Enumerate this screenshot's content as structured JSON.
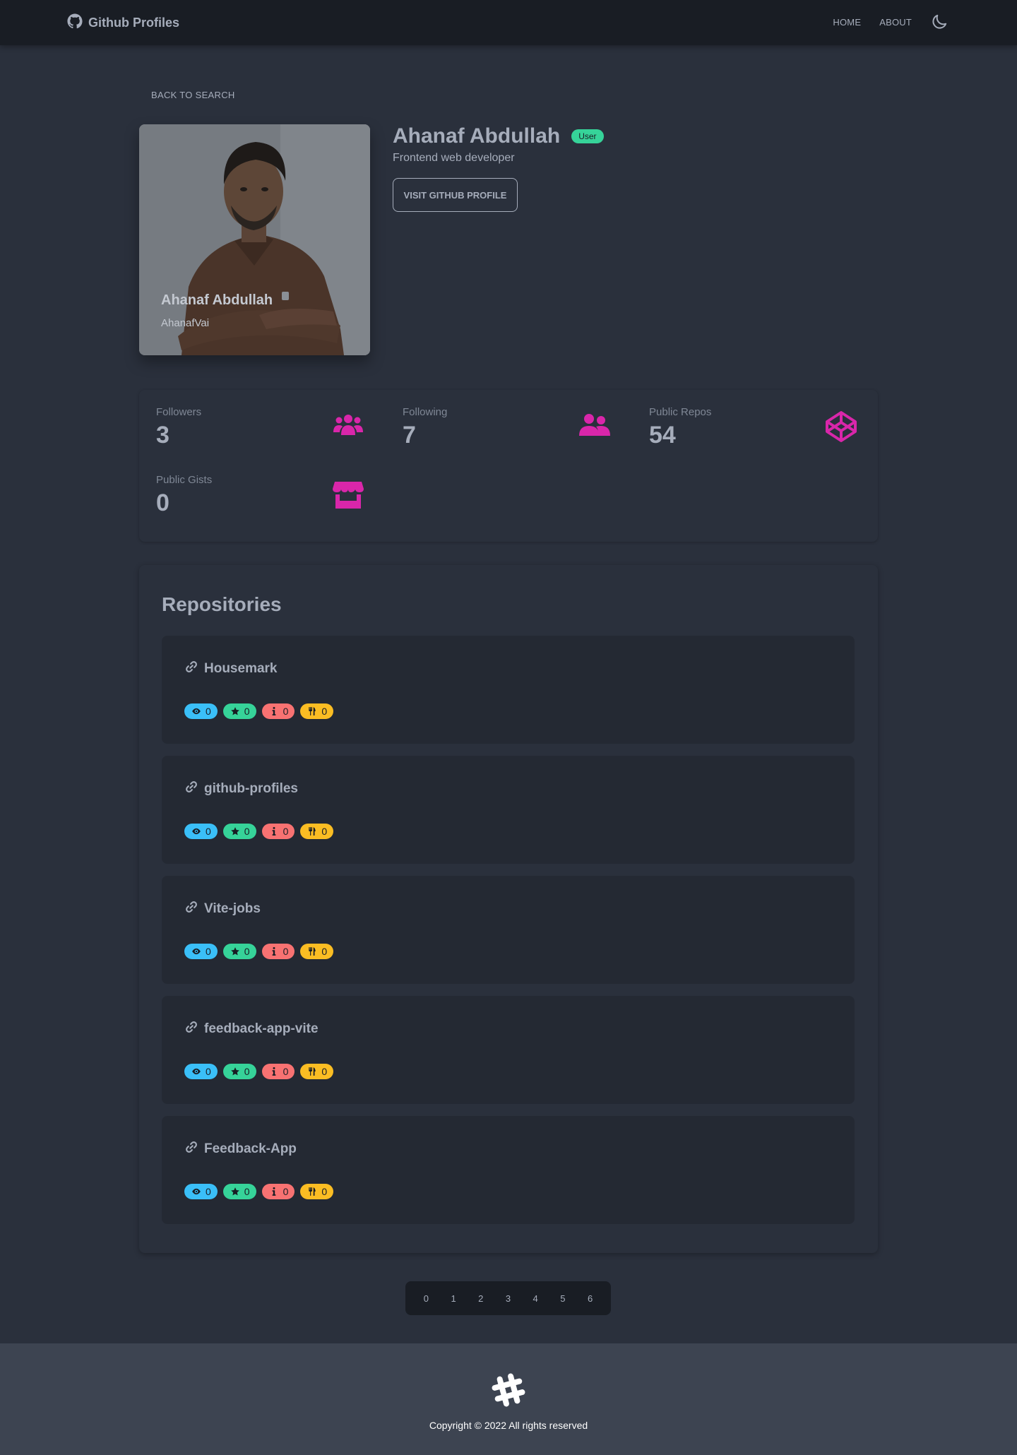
{
  "navbar": {
    "brand": "Github Profiles",
    "links": [
      "HOME",
      "ABOUT"
    ]
  },
  "back_label": "BACK TO SEARCH",
  "profile": {
    "name": "Ahanaf Abdullah",
    "login": "AhanafVai",
    "type_badge": "User",
    "bio": "Frontend web developer",
    "visit_label": "VISIT GITHUB PROFILE"
  },
  "stats": [
    {
      "title": "Followers",
      "value": "3",
      "icon": "users-icon"
    },
    {
      "title": "Following",
      "value": "7",
      "icon": "user-friends-icon"
    },
    {
      "title": "Public Repos",
      "value": "54",
      "icon": "codepen-icon"
    },
    {
      "title": "Public Gists",
      "value": "0",
      "icon": "store-icon"
    }
  ],
  "repositories": {
    "title": "Repositories",
    "items": [
      {
        "name": "Housemark",
        "watchers": "0",
        "stars": "0",
        "issues": "0",
        "forks": "0"
      },
      {
        "name": "github-profiles",
        "watchers": "0",
        "stars": "0",
        "issues": "0",
        "forks": "0"
      },
      {
        "name": "Vite-jobs",
        "watchers": "0",
        "stars": "0",
        "issues": "0",
        "forks": "0"
      },
      {
        "name": "feedback-app-vite",
        "watchers": "0",
        "stars": "0",
        "issues": "0",
        "forks": "0"
      },
      {
        "name": "Feedback-App",
        "watchers": "0",
        "stars": "0",
        "issues": "0",
        "forks": "0"
      }
    ]
  },
  "pagination": [
    "0",
    "1",
    "2",
    "3",
    "4",
    "5",
    "6"
  ],
  "footer": {
    "copyright": "Copyright © 2022 All rights reserved"
  },
  "colors": {
    "accent_icon": "#d926aa",
    "badge_user": "#36d399",
    "watch": "#3abff8",
    "star": "#36d399",
    "issue": "#f87272",
    "fork": "#fbbd23"
  }
}
